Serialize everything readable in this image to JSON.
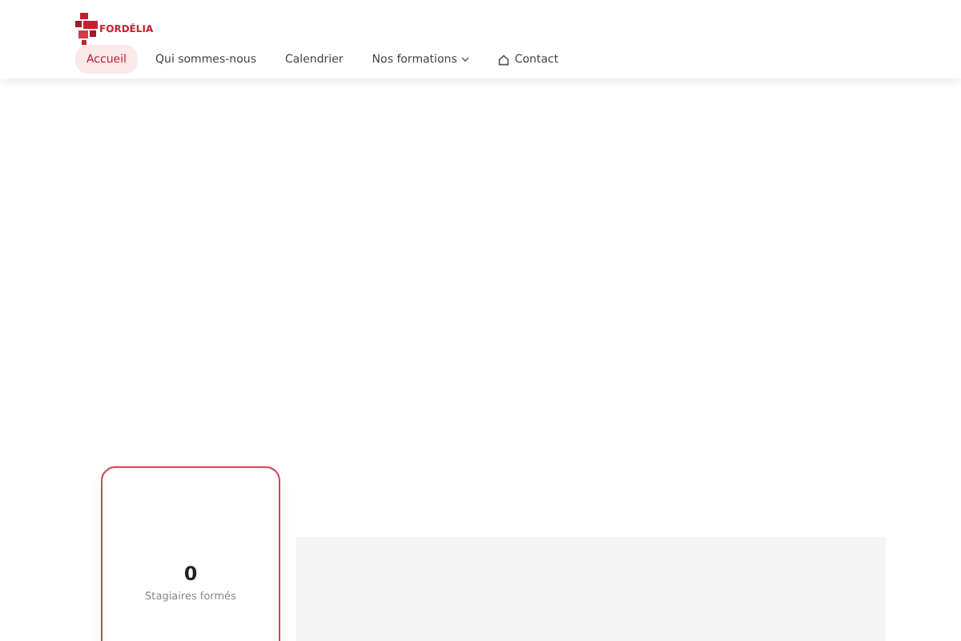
{
  "logo": {
    "text": "FORDÉLIA"
  },
  "nav": [
    {
      "label": "Accueil",
      "selected": true,
      "kind": "link"
    },
    {
      "label": "Qui sommes-nous",
      "selected": false,
      "kind": "link"
    },
    {
      "label": "Calendrier",
      "selected": false,
      "kind": "link"
    },
    {
      "label": "Nos formations",
      "selected": false,
      "kind": "dropdown"
    },
    {
      "label": "Contact",
      "selected": false,
      "kind": "contact"
    }
  ],
  "stats": [
    {
      "value": "0",
      "label": "Stagiaires formés"
    }
  ]
}
